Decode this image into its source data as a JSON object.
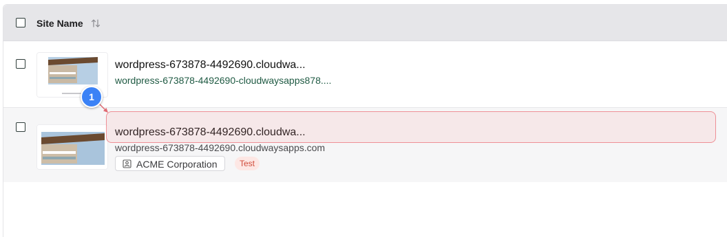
{
  "header": {
    "column_title": "Site Name"
  },
  "rows": [
    {
      "title": "wordpress-673878-4492690.cloudwa...",
      "url": "wordpress-673878-4492690-cloudwaysapps878...."
    },
    {
      "title": "wordpress-673878-4492690.cloudwa...",
      "url": "wordpress-673878-4492690.cloudwaysapps.com",
      "organization": "ACME Corporation",
      "environment": "Test"
    }
  ],
  "annotation": {
    "step_number": "1"
  },
  "colors": {
    "header_bg": "#e6e6e9",
    "url_green": "#1f5a43",
    "highlight_border": "#ee8f95",
    "marker_blue": "#3b82f6",
    "badge_text": "#cf4b3a",
    "badge_bg": "#fde7e4"
  },
  "icons": [
    "sort-icon",
    "user-badge-icon"
  ]
}
